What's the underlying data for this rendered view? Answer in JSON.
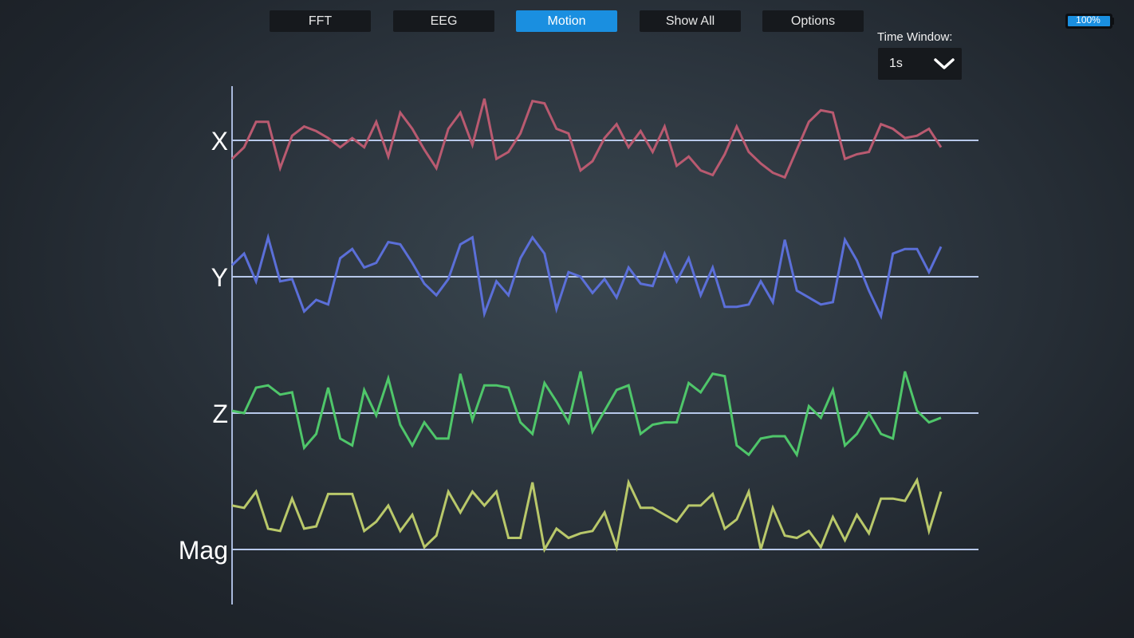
{
  "tabs": [
    {
      "label": "FFT",
      "active": false
    },
    {
      "label": "EEG",
      "active": false
    },
    {
      "label": "Motion",
      "active": true
    },
    {
      "label": "Show All",
      "active": false
    },
    {
      "label": "Options",
      "active": false
    }
  ],
  "time_window": {
    "label": "Time Window:",
    "value": "1s"
  },
  "battery": {
    "label": "100%",
    "level": 1.0
  },
  "colors": {
    "accent": "#1a8fe0",
    "baseline": "#b7c8ea",
    "axis": "#a9b9dc"
  },
  "chart_data": {
    "type": "line",
    "channels": [
      {
        "name": "X",
        "color": "#b95a70",
        "values": [
          -0.8,
          -0.3,
          0.8,
          0.8,
          -1.2,
          0.2,
          0.6,
          0.4,
          0.1,
          -0.3,
          0.1,
          -0.3,
          0.8,
          -0.7,
          1.2,
          0.5,
          -0.4,
          -1.2,
          0.5,
          1.2,
          -0.2,
          1.8,
          -0.8,
          -0.5,
          0.3,
          1.7,
          1.6,
          0.5,
          0.3,
          -1.3,
          -0.9,
          0.1,
          0.7,
          -0.3,
          0.4,
          -0.5,
          0.6,
          -1.1,
          -0.7,
          -1.3,
          -1.5,
          -0.6,
          0.6,
          -0.5,
          -1.0,
          -1.4,
          -1.6,
          -0.4,
          0.8,
          1.3,
          1.2,
          -0.8,
          -0.6,
          -0.5,
          0.7,
          0.5,
          0.1,
          0.2,
          0.5,
          -0.3
        ]
      },
      {
        "name": "Y",
        "color": "#5b6fd8",
        "values": [
          0.5,
          1.0,
          -0.2,
          1.7,
          -0.2,
          -0.1,
          -1.5,
          -1.0,
          -1.2,
          0.8,
          1.2,
          0.4,
          0.6,
          1.5,
          1.4,
          0.6,
          -0.3,
          -0.8,
          -0.1,
          1.4,
          1.7,
          -1.6,
          -0.2,
          -0.8,
          0.8,
          1.7,
          1.0,
          -1.4,
          0.2,
          0.0,
          -0.7,
          -0.1,
          -0.9,
          0.4,
          -0.3,
          -0.4,
          1.0,
          -0.2,
          0.8,
          -0.8,
          0.4,
          -1.3,
          -1.3,
          -1.2,
          -0.2,
          -1.1,
          1.6,
          -0.6,
          -0.9,
          -1.2,
          -1.1,
          1.6,
          0.7,
          -0.6,
          -1.7,
          1.0,
          1.2,
          1.2,
          0.2,
          1.3
        ]
      },
      {
        "name": "Z",
        "color": "#4fc66a",
        "values": [
          0.1,
          0.0,
          1.1,
          1.2,
          0.8,
          0.9,
          -1.5,
          -0.9,
          1.1,
          -1.1,
          -1.4,
          1.0,
          -0.1,
          1.5,
          -0.5,
          -1.4,
          -0.4,
          -1.1,
          -1.1,
          1.7,
          -0.3,
          1.2,
          1.2,
          1.1,
          -0.4,
          -0.9,
          1.3,
          0.5,
          -0.4,
          1.8,
          -0.8,
          0.1,
          1.0,
          1.2,
          -0.9,
          -0.5,
          -0.4,
          -0.4,
          1.3,
          0.9,
          1.7,
          1.6,
          -1.4,
          -1.8,
          -1.1,
          -1.0,
          -1.0,
          -1.8,
          0.3,
          -0.2,
          1.0,
          -1.4,
          -0.9,
          0.0,
          -0.9,
          -1.1,
          1.8,
          0.1,
          -0.4,
          -0.2
        ]
      },
      {
        "name": "Mag",
        "color": "#b9c86a",
        "values": [
          1.9,
          1.8,
          2.5,
          0.9,
          0.8,
          2.2,
          0.9,
          1.0,
          2.4,
          2.4,
          2.4,
          0.8,
          1.2,
          1.9,
          0.8,
          1.5,
          0.1,
          0.6,
          2.5,
          1.6,
          2.5,
          1.9,
          2.5,
          0.5,
          0.5,
          2.9,
          0.0,
          0.9,
          0.5,
          0.7,
          0.8,
          1.6,
          0.1,
          2.9,
          1.8,
          1.8,
          1.5,
          1.2,
          1.9,
          1.9,
          2.4,
          0.9,
          1.3,
          2.5,
          0.0,
          1.8,
          0.6,
          0.5,
          0.8,
          0.1,
          1.4,
          0.4,
          1.5,
          0.7,
          2.2,
          2.2,
          2.1,
          3.0,
          0.8,
          2.5
        ]
      }
    ],
    "xlabel": "",
    "ylabel": "",
    "grid": false,
    "legend": "none"
  }
}
